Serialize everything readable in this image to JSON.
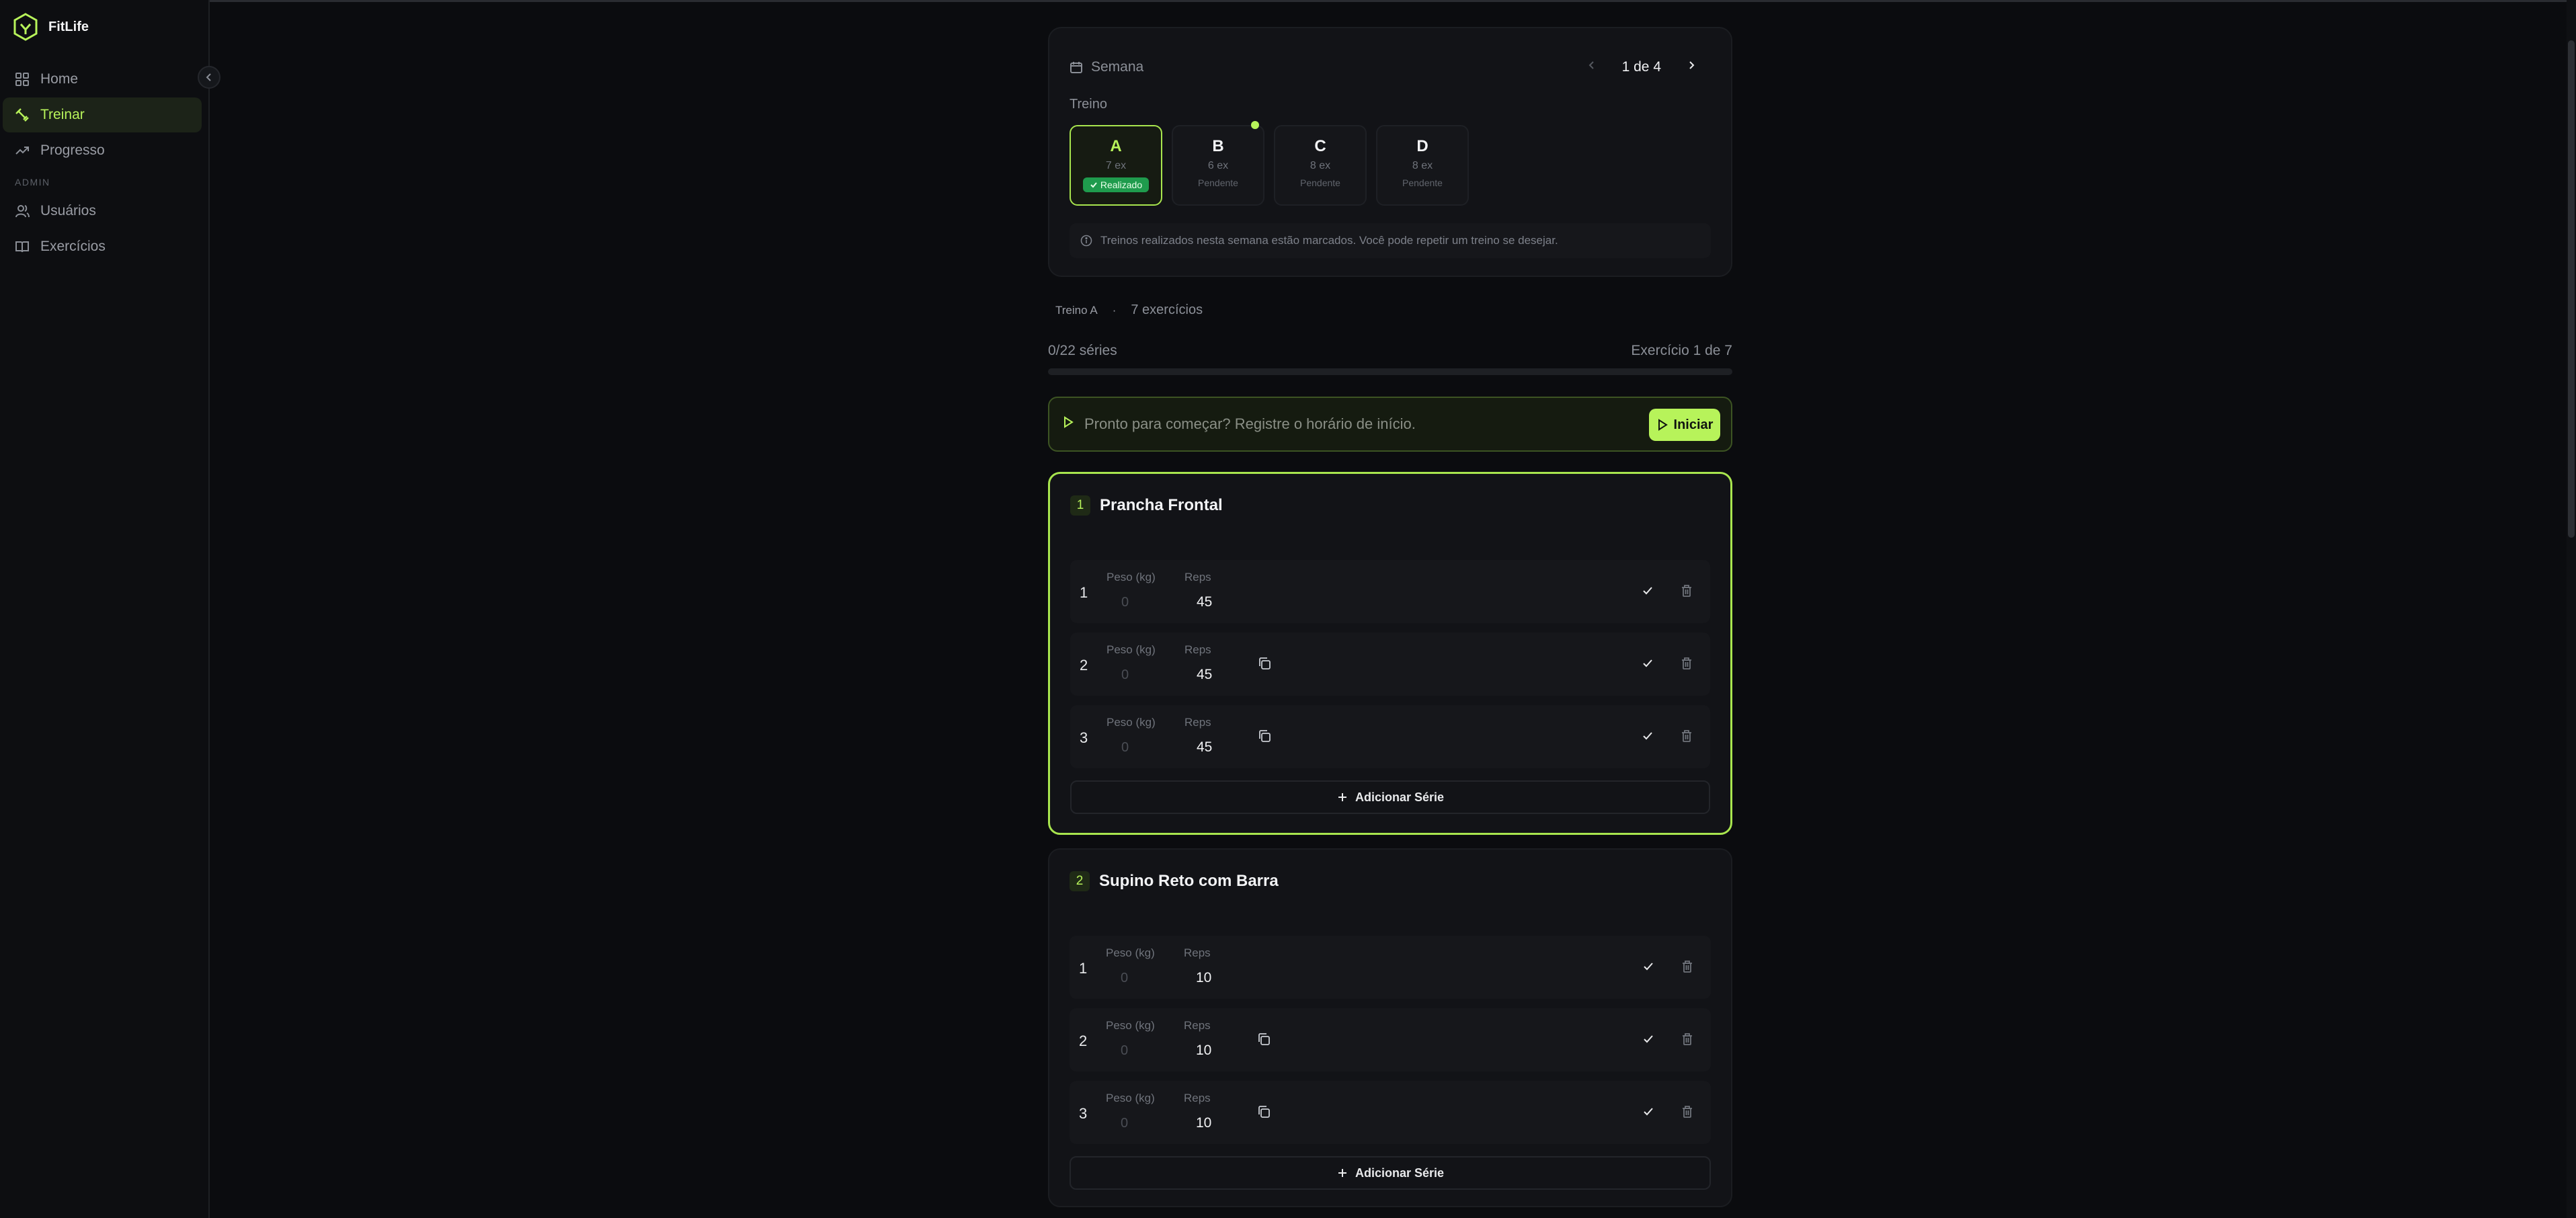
{
  "app": {
    "name": "FitLife"
  },
  "sidebar": {
    "items": [
      {
        "label": "Home",
        "icon": "grid-icon",
        "active": false
      },
      {
        "label": "Treinar",
        "icon": "dumbbell-icon",
        "active": true
      },
      {
        "label": "Progresso",
        "icon": "trend-up-icon",
        "active": false
      }
    ],
    "admin_label": "ADMIN",
    "admin_items": [
      {
        "label": "Usuários",
        "icon": "users-icon"
      },
      {
        "label": "Exercícios",
        "icon": "book-icon"
      }
    ]
  },
  "week": {
    "label": "Semana",
    "pager": "1 de 4",
    "treino_label": "Treino",
    "tiles": [
      {
        "letter": "A",
        "count": "7 ex",
        "status": "Realizado",
        "active": true
      },
      {
        "letter": "B",
        "count": "6 ex",
        "status": "Pendente",
        "active": false
      },
      {
        "letter": "C",
        "count": "8 ex",
        "status": "Pendente",
        "active": false
      },
      {
        "letter": "D",
        "count": "8 ex",
        "status": "Pendente",
        "active": false
      }
    ],
    "info": "Treinos realizados nesta semana estão marcados. Você pode repetir um treino se desejar."
  },
  "session": {
    "treino": "Treino A",
    "sep": "·",
    "exercises": "7 exercícios",
    "series_progress": "0/22 séries",
    "exercise_progress": "Exercício 1 de 7",
    "progress_fraction": 0
  },
  "start": {
    "prompt": "Pronto para começar? Registre o horário de início.",
    "button": "Iniciar"
  },
  "labels": {
    "peso": "Peso (kg)",
    "reps": "Reps",
    "add_set": "Adicionar Série",
    "peso_placeholder": "0"
  },
  "exercises": [
    {
      "number": "1",
      "name": "Prancha Frontal",
      "sets": [
        {
          "n": "1",
          "reps": "45"
        },
        {
          "n": "2",
          "reps": "45"
        },
        {
          "n": "3",
          "reps": "45"
        }
      ]
    },
    {
      "number": "2",
      "name": "Supino Reto com Barra",
      "sets": [
        {
          "n": "1",
          "reps": "10"
        },
        {
          "n": "2",
          "reps": "10"
        },
        {
          "n": "3",
          "reps": "10"
        }
      ]
    }
  ],
  "colors": {
    "accent": "#b7f35a",
    "success": "#1f9b4d",
    "background": "#0b0c0f",
    "card": "#121317"
  }
}
